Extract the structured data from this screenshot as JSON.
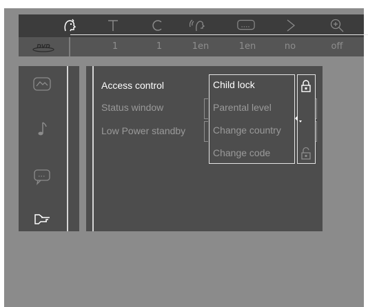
{
  "colors": {
    "screen_bg": "#8b8b8b",
    "panel_bg": "#4d4d4d",
    "icon_bar_bg": "#3c3c3c",
    "value_bar_bg": "#555555",
    "active_text": "#ffffff",
    "dim_text": "#9a9a9a"
  },
  "top_bar": {
    "logo": "DVD",
    "icons": [
      {
        "name": "user-prefs-icon",
        "value": "1"
      },
      {
        "name": "title-icon",
        "value": "1"
      },
      {
        "name": "chapter-icon",
        "value": "1en"
      },
      {
        "name": "audio-language-icon",
        "value": "1en"
      },
      {
        "name": "subtitle-icon",
        "value": "no"
      },
      {
        "name": "angle-icon",
        "value": ""
      },
      {
        "name": "zoom-icon",
        "value": "off"
      }
    ],
    "values": [
      "1",
      "1",
      "1en",
      "1en",
      "no",
      "off"
    ]
  },
  "sidebar": {
    "items": [
      {
        "name": "picture-settings-icon",
        "active": false
      },
      {
        "name": "sound-settings-icon",
        "active": false
      },
      {
        "name": "language-settings-icon",
        "active": false
      },
      {
        "name": "features-settings-icon",
        "active": true
      }
    ]
  },
  "main_menu": {
    "items": [
      {
        "label": "Access control",
        "active": true
      },
      {
        "label": "Status window",
        "active": false
      },
      {
        "label": "Low Power standby",
        "active": false
      }
    ]
  },
  "submenu": {
    "items": [
      {
        "label": "Child lock",
        "active": true
      },
      {
        "label": "Parental level",
        "active": false
      },
      {
        "label": "Change country",
        "active": false
      },
      {
        "label": "Change code",
        "active": false
      }
    ],
    "lock_options": [
      {
        "name": "locked-padlock-icon",
        "selected": true
      },
      {
        "name": "unlocked-padlock-icon",
        "selected": false
      }
    ]
  }
}
